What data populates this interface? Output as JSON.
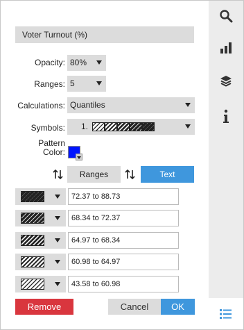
{
  "title": "Voter Turnout (%)",
  "opacity": {
    "label": "Opacity:",
    "value": "80%"
  },
  "ranges": {
    "label": "Ranges:",
    "value": "5"
  },
  "calculations": {
    "label": "Calculations:",
    "value": "Quantiles"
  },
  "symbols": {
    "label": "Symbols:",
    "value": "1."
  },
  "pattern_color": {
    "label_line1": "Pattern",
    "label_line2": "Color:",
    "color": "#0015ff"
  },
  "tabs": {
    "ranges_label": "Ranges",
    "text_label": "Text"
  },
  "rows": [
    {
      "value": "72.37 to 88.73",
      "density": 5
    },
    {
      "value": "68.34 to 72.37",
      "density": 4
    },
    {
      "value": "64.97 to 68.34",
      "density": 3
    },
    {
      "value": "60.98 to 64.97",
      "density": 2
    },
    {
      "value": "43.58 to 60.98",
      "density": 1
    }
  ],
  "buttons": {
    "remove": "Remove",
    "cancel": "Cancel",
    "ok": "OK"
  },
  "sidebar": {
    "icons": [
      "search-icon",
      "bar-chart-icon",
      "layers-icon",
      "info-icon",
      "legend-list-icon"
    ],
    "active": "legend-list-icon"
  },
  "colors": {
    "accent": "#3f97dd",
    "danger": "#d9363e",
    "field": "#dcdcdc"
  }
}
